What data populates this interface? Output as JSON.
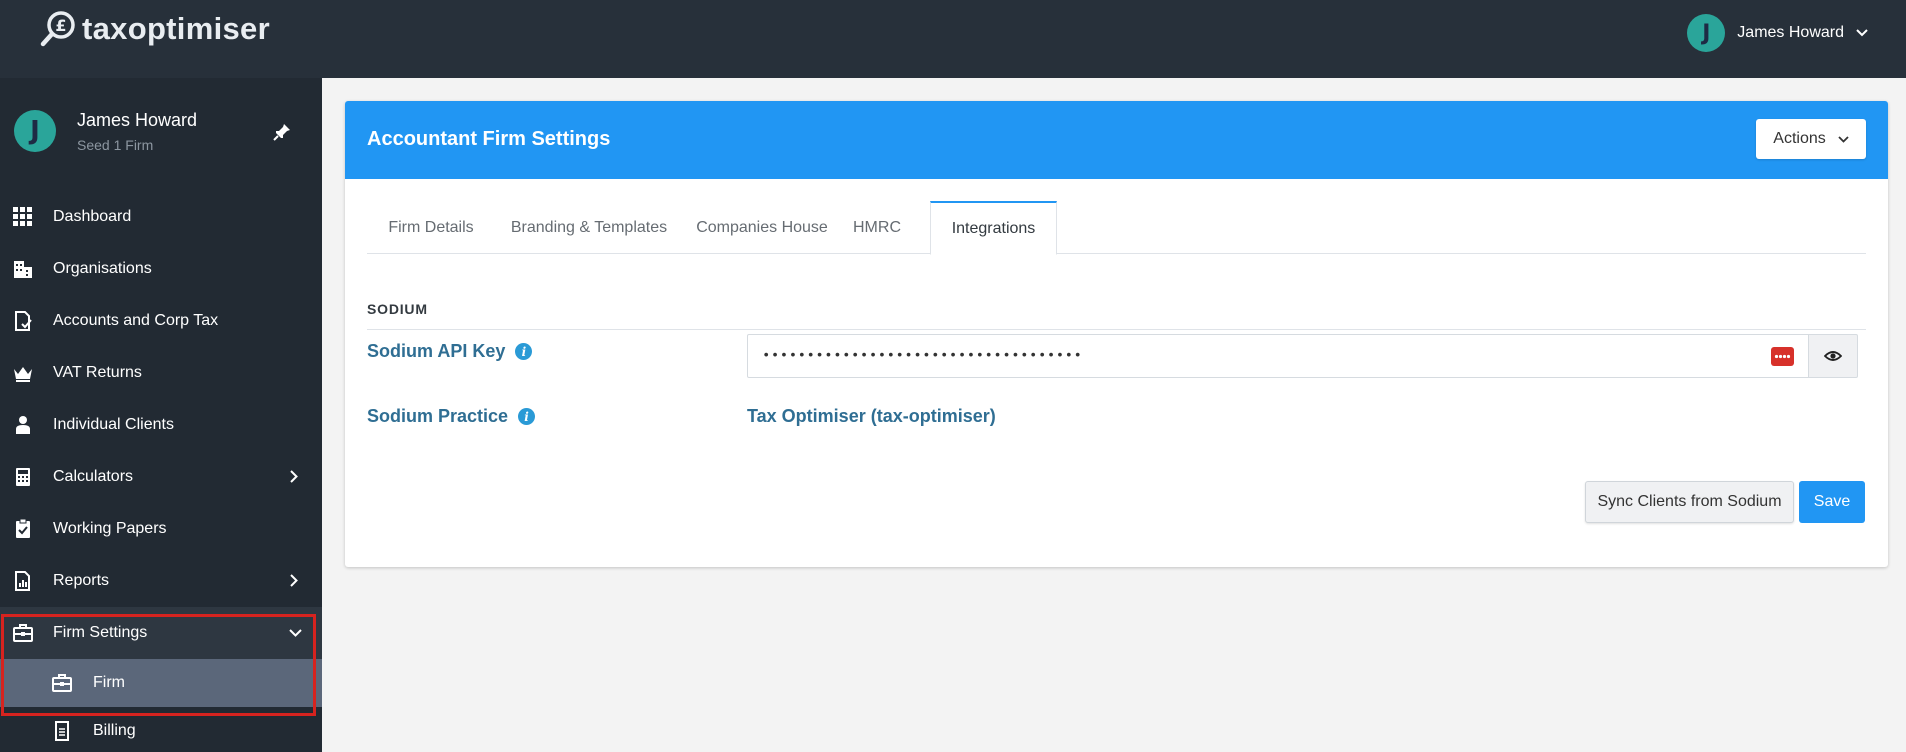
{
  "app": {
    "logo_text": "taxoptimiser",
    "brand_color": "#2196f3"
  },
  "topbar": {
    "user_name": "James Howard",
    "avatar_initial": "J"
  },
  "sidebar": {
    "profile": {
      "name": "James Howard",
      "firm": "Seed 1 Firm",
      "avatar_initial": "J"
    },
    "items": [
      {
        "label": "Dashboard",
        "icon": "grid-icon"
      },
      {
        "label": "Organisations",
        "icon": "building-icon"
      },
      {
        "label": "Accounts and Corp Tax",
        "icon": "document-check-icon"
      },
      {
        "label": "VAT Returns",
        "icon": "crown-icon"
      },
      {
        "label": "Individual Clients",
        "icon": "person-icon"
      },
      {
        "label": "Calculators",
        "icon": "calculator-icon",
        "has_submenu": true
      },
      {
        "label": "Working Papers",
        "icon": "clipboard-check-icon"
      },
      {
        "label": "Reports",
        "icon": "report-icon",
        "has_submenu": true
      },
      {
        "label": "Firm Settings",
        "icon": "briefcase-icon",
        "expanded": true
      }
    ],
    "sub_items": [
      {
        "label": "Firm",
        "icon": "briefcase-icon",
        "active": true
      },
      {
        "label": "Billing",
        "icon": "invoice-icon"
      }
    ]
  },
  "card": {
    "title": "Accountant Firm Settings",
    "actions_label": "Actions",
    "tabs": [
      {
        "label": "Firm Details"
      },
      {
        "label": "Branding & Templates"
      },
      {
        "label": "Companies House"
      },
      {
        "label": "HMRC"
      },
      {
        "label": "Integrations",
        "active": true
      }
    ],
    "section_title": "SODIUM",
    "api_key": {
      "label": "Sodium API Key",
      "value": "••••••••••••••••••••••••••••••••••••"
    },
    "practice": {
      "label": "Sodium Practice",
      "value": "Tax Optimiser (tax-optimiser)"
    },
    "sync_label": "Sync Clients from Sodium",
    "save_label": "Save"
  }
}
